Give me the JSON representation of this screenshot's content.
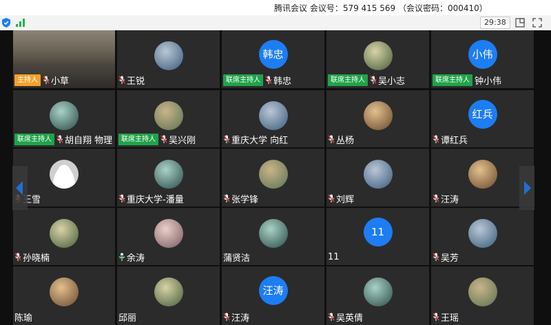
{
  "window": {
    "title": "腾讯会议 会议号：579 415 569 （会议密码：000410）"
  },
  "toolbar": {
    "timer": "29:38",
    "icons": [
      "shield-icon",
      "signal-bars-icon",
      "layout-icon",
      "fullscreen-icon"
    ]
  },
  "colors": {
    "grid_bg": "#0f0f10",
    "tile_bg": "#2b2b2b",
    "avatar_blue": "#1d7df3",
    "host_badge": "#f2a12a",
    "cohost_badge": "#21a34a",
    "mic_muted": "#e03a3a",
    "mic_active": "#28b04a",
    "nav_arrow": "#1d7df3"
  },
  "participants": [
    {
      "name": "小草",
      "badge": "主持人",
      "badge_type": "host",
      "mic": "muted",
      "avatar": "video"
    },
    {
      "name": "王锐",
      "badge": "",
      "badge_type": "",
      "mic": "muted",
      "avatar": "photo"
    },
    {
      "name": "韩忠",
      "badge": "联席主持人",
      "badge_type": "cohost",
      "mic": "muted",
      "avatar": "text",
      "avatar_text": "韩忠"
    },
    {
      "name": "吴小志",
      "badge": "联席主持人",
      "badge_type": "cohost",
      "mic": "muted",
      "avatar": "photo"
    },
    {
      "name": "钟小伟",
      "badge": "联席主持人",
      "badge_type": "cohost",
      "mic": "none",
      "avatar": "text",
      "avatar_text": "小伟"
    },
    {
      "name": "胡自翔 物理",
      "badge": "联席主持人",
      "badge_type": "cohost",
      "mic": "muted",
      "avatar": "photo"
    },
    {
      "name": "吴兴刚",
      "badge": "联席主持人",
      "badge_type": "cohost",
      "mic": "muted",
      "avatar": "photo"
    },
    {
      "name": "重庆大学 向红",
      "badge": "",
      "badge_type": "",
      "mic": "muted",
      "avatar": "photo"
    },
    {
      "name": "丛杨",
      "badge": "",
      "badge_type": "",
      "mic": "muted",
      "avatar": "photo"
    },
    {
      "name": "谭红兵",
      "badge": "",
      "badge_type": "",
      "mic": "muted",
      "avatar": "text",
      "avatar_text": "红兵"
    },
    {
      "name": "王雪",
      "badge": "",
      "badge_type": "",
      "mic": "muted",
      "avatar": "default"
    },
    {
      "name": "重庆大学-潘量",
      "badge": "",
      "badge_type": "",
      "mic": "muted",
      "avatar": "photo"
    },
    {
      "name": "张学锋",
      "badge": "",
      "badge_type": "",
      "mic": "muted",
      "avatar": "photo"
    },
    {
      "name": "刘辉",
      "badge": "",
      "badge_type": "",
      "mic": "muted",
      "avatar": "photo"
    },
    {
      "name": "汪涛",
      "badge": "",
      "badge_type": "",
      "mic": "muted",
      "avatar": "photo"
    },
    {
      "name": "孙晓楠",
      "badge": "",
      "badge_type": "",
      "mic": "muted",
      "avatar": "photo"
    },
    {
      "name": "余涛",
      "badge": "",
      "badge_type": "",
      "mic": "active",
      "avatar": "photo"
    },
    {
      "name": "蒲贤洁",
      "badge": "",
      "badge_type": "",
      "mic": "none",
      "avatar": "photo"
    },
    {
      "name": "11",
      "badge": "",
      "badge_type": "",
      "mic": "none",
      "avatar": "text",
      "avatar_text": "11"
    },
    {
      "name": "吴芳",
      "badge": "",
      "badge_type": "",
      "mic": "muted",
      "avatar": "photo"
    },
    {
      "name": "陈瑜",
      "badge": "",
      "badge_type": "",
      "mic": "none",
      "avatar": "photo"
    },
    {
      "name": "邱丽",
      "badge": "",
      "badge_type": "",
      "mic": "none",
      "avatar": "photo"
    },
    {
      "name": "汪涛",
      "badge": "",
      "badge_type": "",
      "mic": "muted",
      "avatar": "text",
      "avatar_text": "汪涛"
    },
    {
      "name": "吴英倩",
      "badge": "",
      "badge_type": "",
      "mic": "muted",
      "avatar": "photo"
    },
    {
      "name": "王瑶",
      "badge": "",
      "badge_type": "",
      "mic": "muted",
      "avatar": "photo"
    }
  ]
}
